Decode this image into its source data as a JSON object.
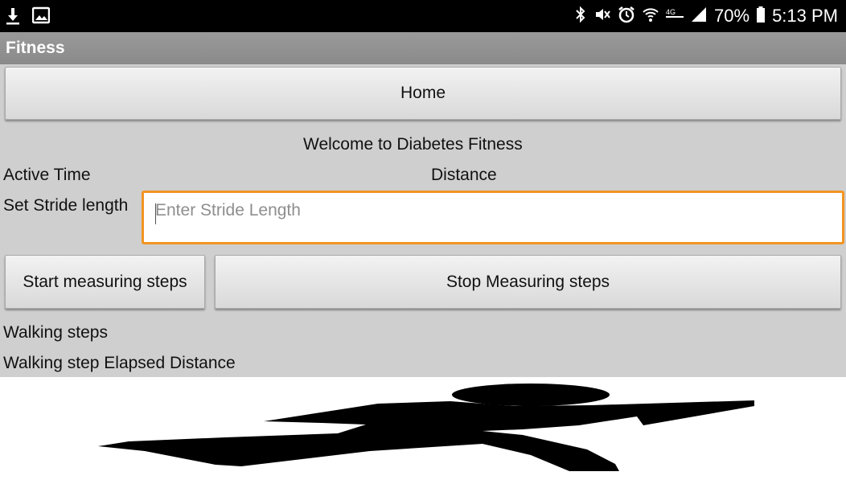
{
  "status_bar": {
    "battery_percent": "70%",
    "time": "5:13 PM",
    "left_icons": [
      "download-icon",
      "image-icon"
    ],
    "right_icons": [
      "bluetooth-icon",
      "mute-icon",
      "alarm-icon",
      "wifi-icon",
      "lte-icon",
      "signal-icon",
      "battery-icon"
    ]
  },
  "app_bar": {
    "title": "Fitness"
  },
  "main": {
    "home_button": "Home",
    "welcome_text": "Welcome to Diabetes Fitness",
    "active_time_label": "Active Time",
    "distance_label": "Distance",
    "stride_label": "Set Stride length",
    "stride_input": {
      "value": "",
      "placeholder": "Enter Stride Length"
    },
    "start_button": "Start measuring steps",
    "stop_button": "Stop Measuring steps",
    "walking_steps_label": "Walking steps",
    "elapsed_distance_label": "Walking step Elapsed Distance"
  },
  "colors": {
    "accent_focus": "#f29422",
    "content_bg": "#cfcfcf",
    "app_bar_bg": "#8f8f8f"
  },
  "image": {
    "subject": "running-figure-silhouette"
  }
}
